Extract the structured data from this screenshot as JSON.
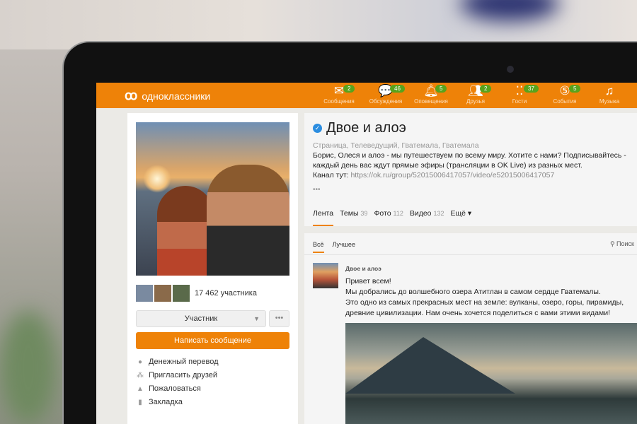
{
  "header": {
    "logo": "одноклассники",
    "nav": [
      {
        "label": "Сообщения",
        "icon": "envelope-icon",
        "badge": "2"
      },
      {
        "label": "Обсуждения",
        "icon": "chat-icon",
        "badge": "46"
      },
      {
        "label": "Оповещения",
        "icon": "bell-icon",
        "badge": "5"
      },
      {
        "label": "Друзья",
        "icon": "friends-icon",
        "badge": "2"
      },
      {
        "label": "Гости",
        "icon": "footprints-icon",
        "badge": "37"
      },
      {
        "label": "События",
        "icon": "events-icon",
        "badge": "5"
      },
      {
        "label": "Музыка",
        "icon": "music-icon",
        "badge": null
      }
    ]
  },
  "sidebar": {
    "members": "17 462 участника",
    "member_select": "Участник",
    "more": "•••",
    "write_message": "Написать сообщение",
    "actions": [
      {
        "label": "Денежный перевод",
        "icon": "money-icon"
      },
      {
        "label": "Пригласить друзей",
        "icon": "invite-icon"
      },
      {
        "label": "Пожаловаться",
        "icon": "warning-icon"
      },
      {
        "label": "Закладка",
        "icon": "bookmark-icon"
      }
    ]
  },
  "group": {
    "title": "Двое и алоэ",
    "categories": "Страница, Телеведущий, Гватемала, Гватемала",
    "description": "Борис, Олеся и алоэ - мы путешествуем по всему миру. Хотите с нами? Подписывайтесь - каждый день вас ждут прямые эфиры (трансляции в OK Live) из разных мест.",
    "channel_label": "Канал тут:",
    "channel_url": "https://ok.ru/group/52015006417057/video/e52015006417057",
    "ellipsis": "•••",
    "tabs": [
      {
        "label": "Лента",
        "count": ""
      },
      {
        "label": "Темы",
        "count": "39"
      },
      {
        "label": "Фото",
        "count": "112"
      },
      {
        "label": "Видео",
        "count": "132"
      },
      {
        "label": "Ещё ▾",
        "count": ""
      }
    ]
  },
  "feed": {
    "filters": [
      "Всё",
      "Лучшее"
    ],
    "search": "Поиск",
    "post": {
      "author": "Двое и алоэ",
      "lines": [
        "Привет всем!",
        "Мы добрались до волшебного озера Атитлан в самом сердце Гватемалы.",
        "Это одно из самых прекрасных мест на земле: вулканы, озеро, горы, пирамиды,",
        "древние цивилизации. Нам очень хочется поделиться с вами этими видами!"
      ]
    }
  }
}
